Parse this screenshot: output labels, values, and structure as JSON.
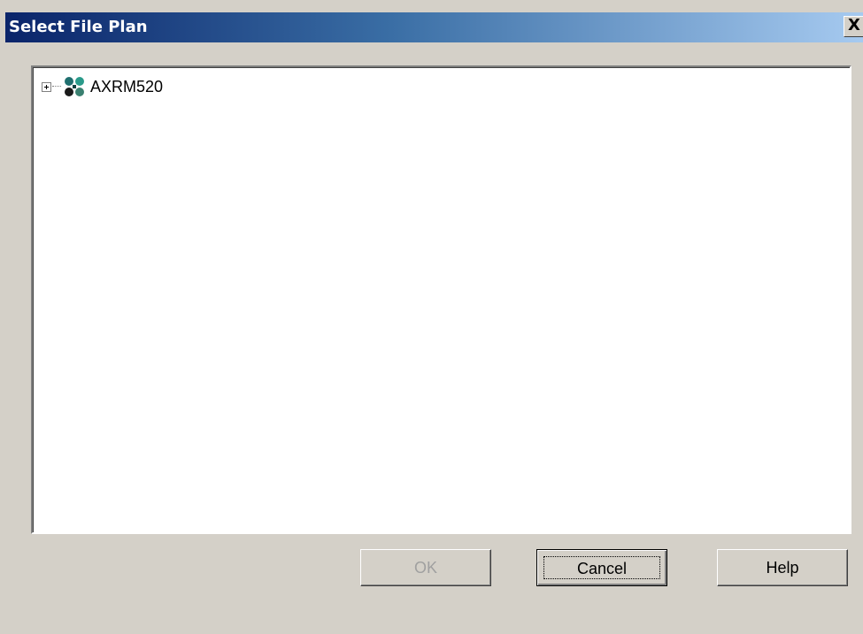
{
  "window": {
    "title": "Select File Plan",
    "close_label": "X"
  },
  "tree": {
    "nodes": [
      {
        "label": "AXRM520",
        "icon": "file-plan-icon",
        "expanded": false
      }
    ]
  },
  "buttons": {
    "ok_label": "OK",
    "cancel_label": "Cancel",
    "help_label": "Help"
  },
  "colors": {
    "title_gradient_start": "#0a246a",
    "title_gradient_end": "#a6caf0",
    "dialog_bg": "#d4d0c8"
  }
}
